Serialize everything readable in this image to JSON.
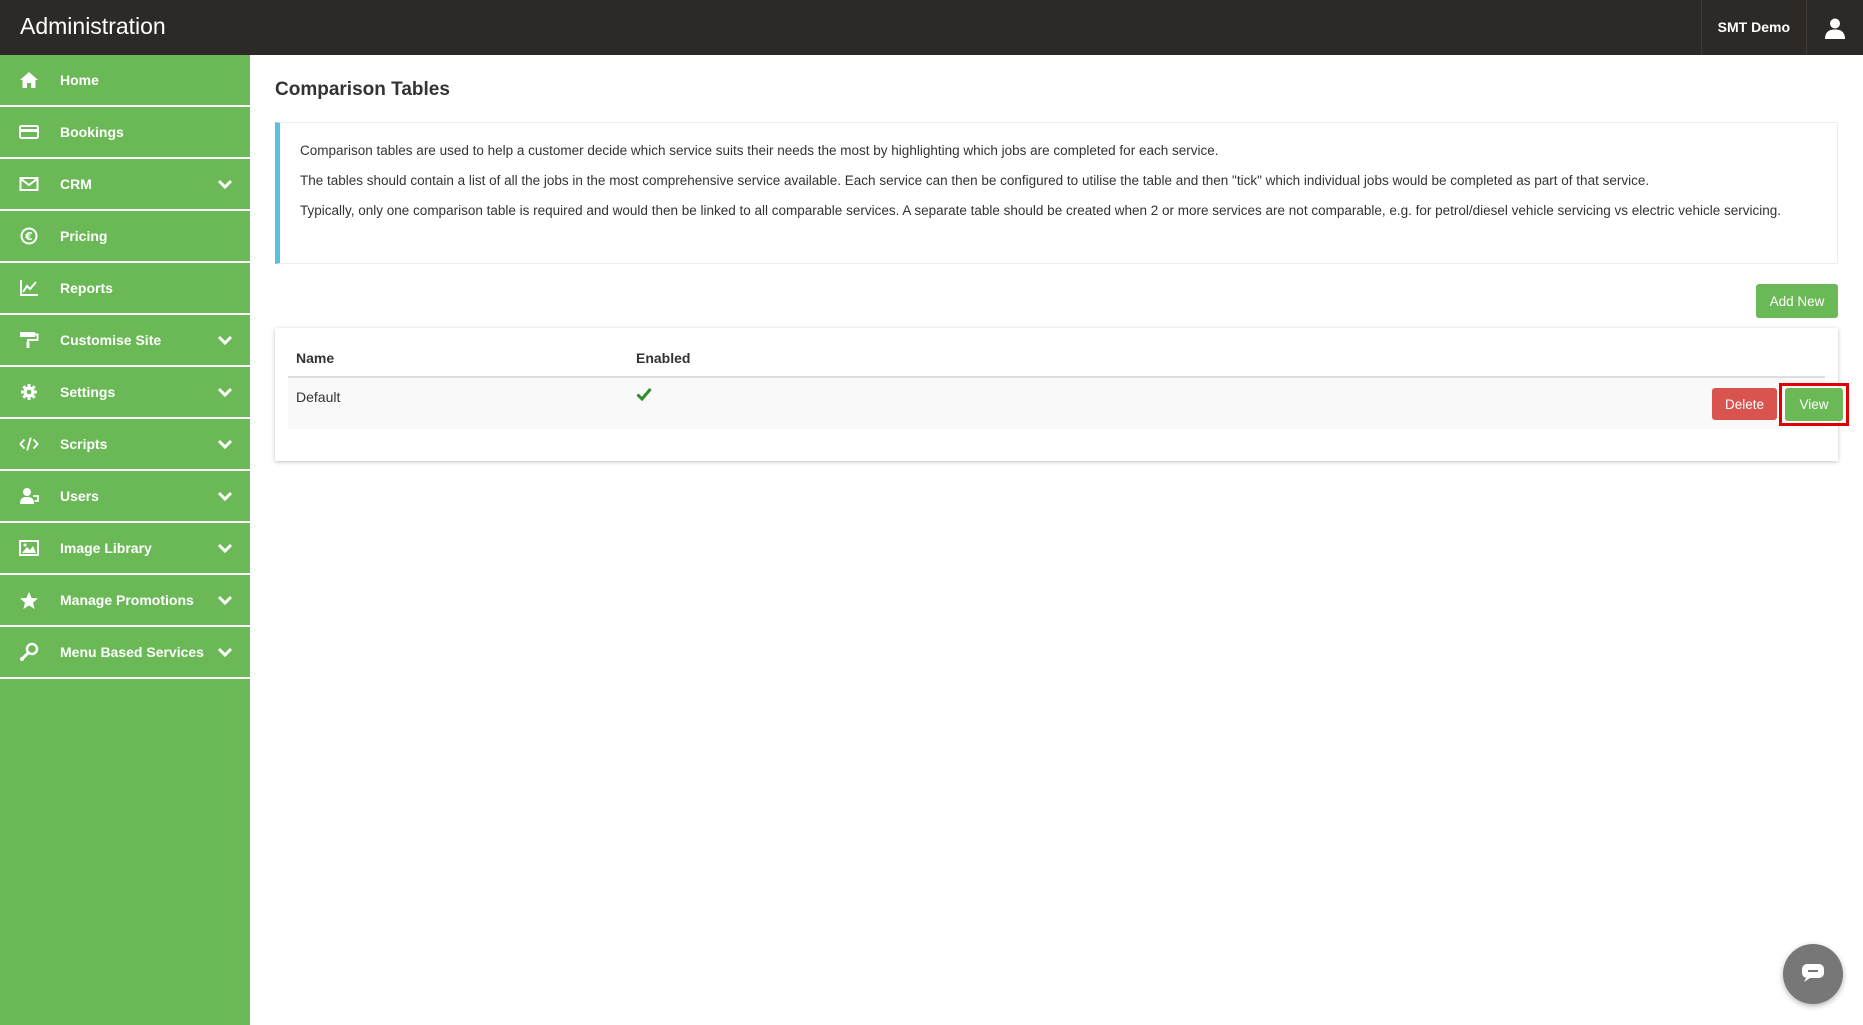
{
  "header": {
    "title": "Administration",
    "user_name": "SMT Demo"
  },
  "sidebar": {
    "items": [
      {
        "label": "Home",
        "icon": "home-icon",
        "has_submenu": false
      },
      {
        "label": "Bookings",
        "icon": "card-icon",
        "has_submenu": false
      },
      {
        "label": "CRM",
        "icon": "envelope-icon",
        "has_submenu": true
      },
      {
        "label": "Pricing",
        "icon": "euro-icon",
        "has_submenu": false
      },
      {
        "label": "Reports",
        "icon": "line-chart-icon",
        "has_submenu": false
      },
      {
        "label": "Customise Site",
        "icon": "paint-roller-icon",
        "has_submenu": true
      },
      {
        "label": "Settings",
        "icon": "gear-icon",
        "has_submenu": true
      },
      {
        "label": "Scripts",
        "icon": "code-icon",
        "has_submenu": true
      },
      {
        "label": "Users",
        "icon": "users-icon",
        "has_submenu": true
      },
      {
        "label": "Image Library",
        "icon": "image-icon",
        "has_submenu": true
      },
      {
        "label": "Manage Promotions",
        "icon": "star-icon",
        "has_submenu": true
      },
      {
        "label": "Menu Based Services",
        "icon": "wrench-icon",
        "has_submenu": true
      }
    ]
  },
  "main": {
    "title": "Comparison Tables",
    "info": {
      "paragraphs": [
        "Comparison tables are used to help a customer decide which service suits their needs the most by highlighting which jobs are completed for each service.",
        "The tables should contain a list of all the jobs in the most comprehensive service available. Each service can then be configured to utilise the table and then \"tick\" which individual jobs would be completed as part of that service.",
        "Typically, only one comparison table is required and would then be linked to all comparable services. A separate table should be created when 2 or more services are not comparable, e.g. for petrol/diesel vehicle servicing vs electric vehicle servicing."
      ]
    },
    "add_new_label": "Add New",
    "table": {
      "columns": [
        "Name",
        "Enabled"
      ],
      "rows": [
        {
          "name": "Default",
          "enabled": true,
          "delete_label": "Delete",
          "view_label": "View"
        }
      ]
    }
  },
  "colors": {
    "header_bg": "#2d2926",
    "sidebar_bg": "#6ab956",
    "accent_green": "#6ab956",
    "danger_red": "#d9534f",
    "info_border": "#5bc0de",
    "highlight_red": "#e00000"
  }
}
